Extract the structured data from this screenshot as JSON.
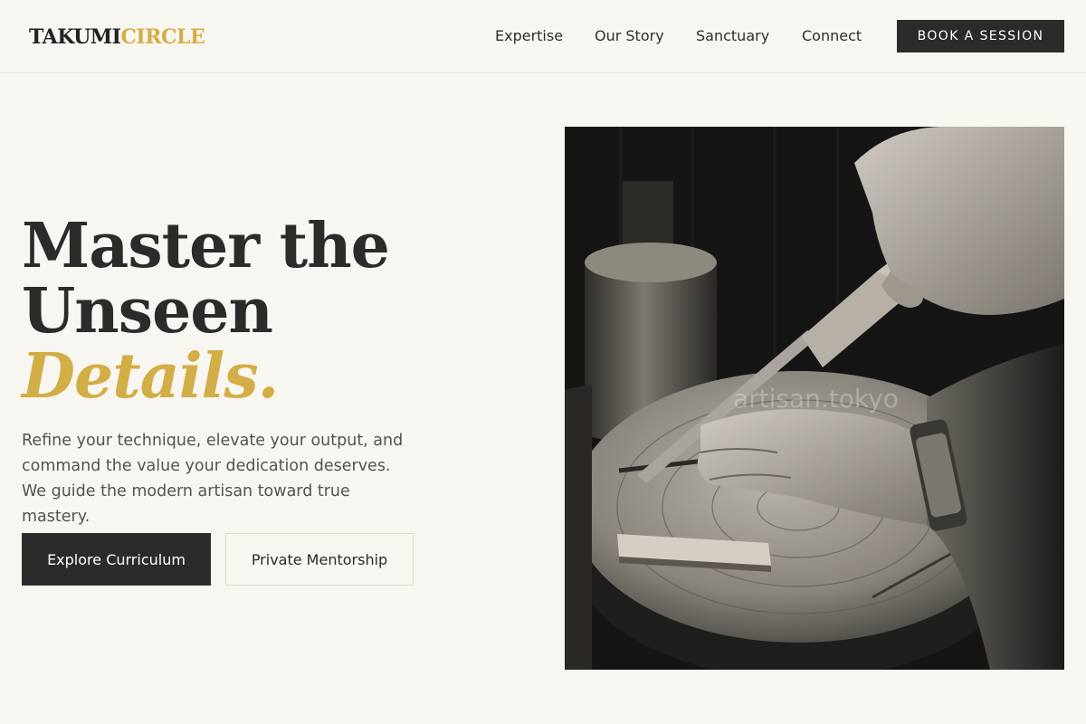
{
  "header": {
    "logo": {
      "part1": "TAKUMI",
      "part2": "CIRCLE"
    },
    "nav": [
      {
        "label": "Expertise"
      },
      {
        "label": "Our Story"
      },
      {
        "label": "Sanctuary"
      },
      {
        "label": "Connect"
      }
    ],
    "cta_label": "BOOK A SESSION"
  },
  "hero": {
    "headline_line1": "Master the",
    "headline_line2": "Unseen",
    "headline_accent": "Details.",
    "subtitle": "Refine your technique, elevate your output, and command the value your dedication deserves. We guide the modern artisan toward true mastery.",
    "primary_button": "Explore Curriculum",
    "secondary_button": "Private Mentorship",
    "image_watermark": "artisan.tokyo"
  },
  "colors": {
    "background": "#f8f6f1",
    "accent_gold": "#d3ad45",
    "dark": "#2b2b2b"
  }
}
